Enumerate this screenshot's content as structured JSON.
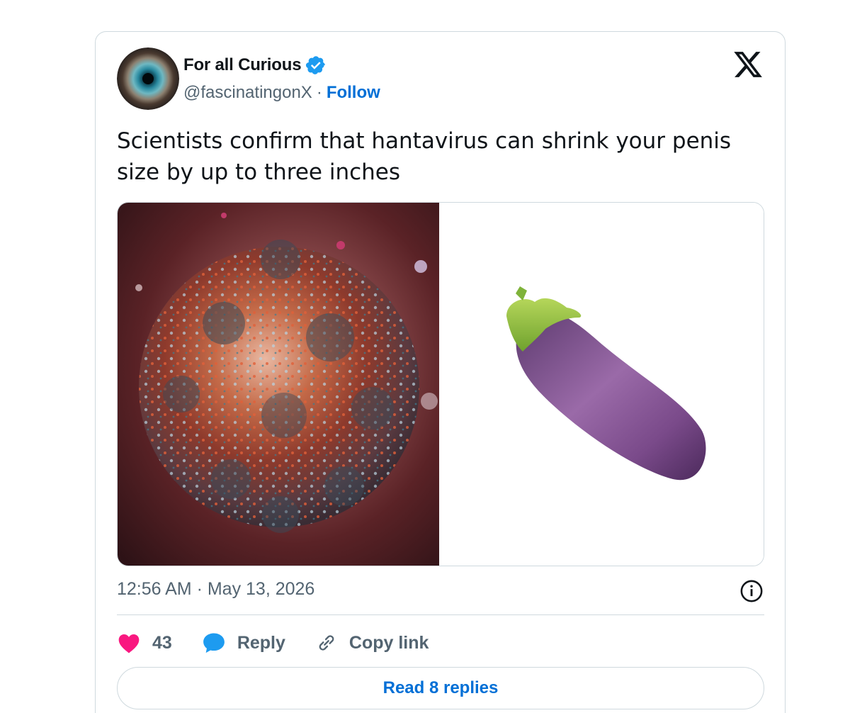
{
  "author": {
    "display_name": "For all Curious",
    "handle": "@fascinatingonX",
    "separator": "·",
    "follow_label": "Follow",
    "verified_color": "#1d9bf0"
  },
  "tweet": {
    "text": "Scientists confirm that hantavirus can shrink your penis size by up to three inches",
    "timestamp": "12:56 AM · May 13, 2026"
  },
  "actions": {
    "like_count": "43",
    "reply_label": "Reply",
    "copy_link_label": "Copy link"
  },
  "read_replies_label": "Read 8 replies",
  "icons": [
    "x-logo-icon",
    "verified-badge-icon",
    "info-icon",
    "heart-icon",
    "reply-bubble-icon",
    "link-icon"
  ],
  "colors": {
    "accent": "#006fd6",
    "like": "#f91880",
    "reply": "#1d9bf0",
    "muted": "#536471",
    "border": "#cfd9de"
  }
}
